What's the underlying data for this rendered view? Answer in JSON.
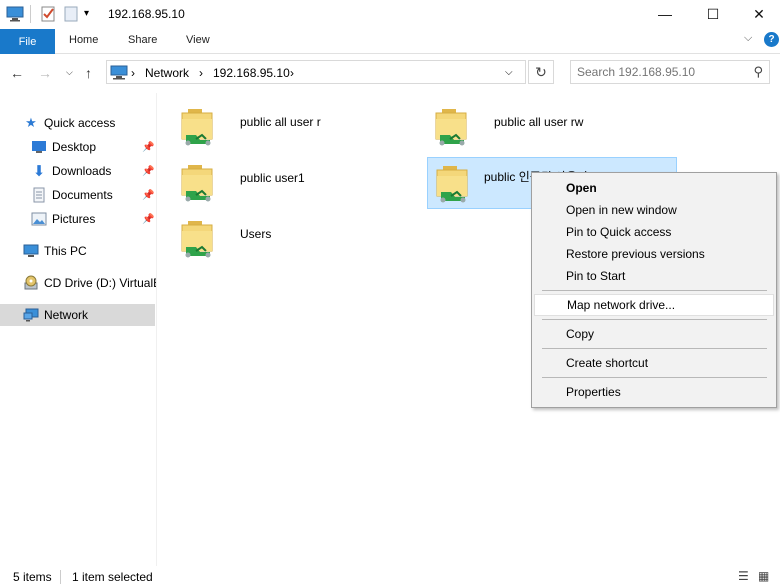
{
  "window": {
    "title": "192.168.95.10",
    "minimize_glyph": "—",
    "maximize_glyph": "☐",
    "close_glyph": "✕"
  },
  "ribbon": {
    "file": "File",
    "tabs": [
      "Home",
      "Share",
      "View"
    ],
    "help": "?"
  },
  "address": {
    "parts": [
      "Network",
      "192.168.95.10"
    ],
    "search_placeholder": "Search 192.168.95.10"
  },
  "nav": {
    "items": [
      {
        "label": "Quick access",
        "icon": "star-icon"
      },
      {
        "label": "Desktop",
        "icon": "desktop-icon",
        "pinned": true
      },
      {
        "label": "Downloads",
        "icon": "download-icon",
        "pinned": true
      },
      {
        "label": "Documents",
        "icon": "documents-icon",
        "pinned": true
      },
      {
        "label": "Pictures",
        "icon": "pictures-icon",
        "pinned": true
      },
      {
        "label": "This PC",
        "icon": "computer-icon"
      },
      {
        "label": "CD Drive (D:) VirtualB",
        "icon": "cd-drive-icon"
      },
      {
        "label": "Network",
        "icon": "network-icon",
        "selected": true
      }
    ]
  },
  "shares": [
    {
      "label": "public all user r"
    },
    {
      "label": "public all user rw"
    },
    {
      "label": "public user1"
    },
    {
      "label": "public 인증된 사용자",
      "selected": true
    },
    {
      "label": "Users"
    }
  ],
  "context_menu": {
    "open": "Open",
    "open_new_window": "Open in new window",
    "pin_quick_access": "Pin to Quick access",
    "restore_versions": "Restore previous versions",
    "pin_start": "Pin to Start",
    "map_drive": "Map network drive...",
    "copy": "Copy",
    "create_shortcut": "Create shortcut",
    "properties": "Properties"
  },
  "status": {
    "items": "5 items",
    "selected": "1 item selected"
  },
  "colors": {
    "accent": "#1979ca",
    "selection_bg": "#cce8ff",
    "selection_border": "#99d1ff",
    "menu_bg": "#f2f2f2"
  }
}
